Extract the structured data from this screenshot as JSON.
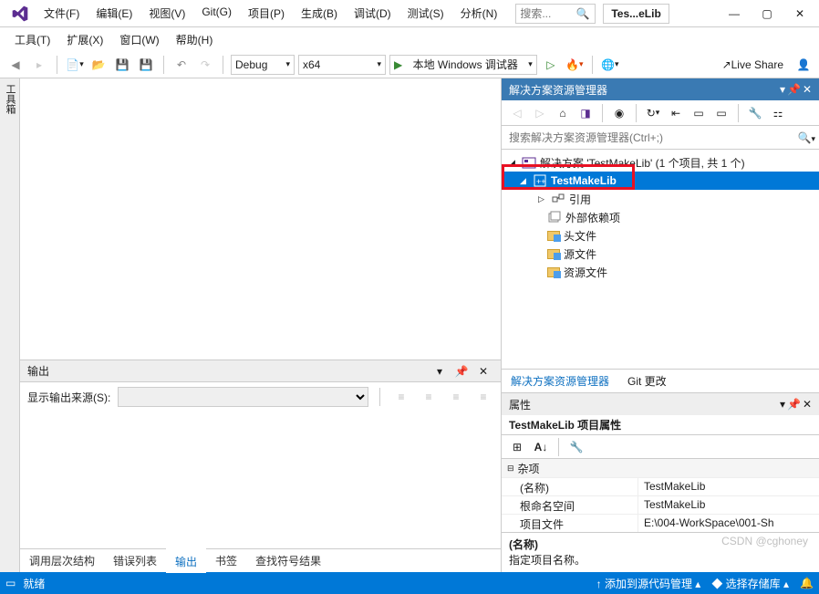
{
  "menu": {
    "file": "文件(F)",
    "edit": "编辑(E)",
    "view": "视图(V)",
    "git": "Git(G)",
    "project": "项目(P)",
    "build": "生成(B)",
    "debug": "调试(D)",
    "test": "测试(S)",
    "analyze": "分析(N)",
    "tools": "工具(T)",
    "extensions": "扩展(X)",
    "window": "窗口(W)",
    "help": "帮助(H)"
  },
  "title_search_placeholder": "搜索...",
  "title_tab": "Tes...eLib",
  "toolbar": {
    "config": "Debug",
    "platform": "x64",
    "debugger": "本地 Windows 调试器",
    "live_share": "Live Share"
  },
  "left_tool": "工具箱",
  "solution_explorer": {
    "title": "解决方案资源管理器",
    "search_placeholder": "搜索解决方案资源管理器(Ctrl+;)",
    "solution": "解决方案 'TestMakeLib' (1 个项目, 共 1 个)",
    "project": "TestMakeLib",
    "items": {
      "references": "引用",
      "ext_deps": "外部依赖项",
      "headers": "头文件",
      "sources": "源文件",
      "resources": "资源文件"
    },
    "tab1": "解决方案资源管理器",
    "tab2": "Git 更改"
  },
  "output": {
    "title": "输出",
    "source_label": "显示输出来源(S):",
    "tabs": {
      "call": "调用层次结构",
      "errors": "错误列表",
      "output": "输出",
      "bookmarks": "书签",
      "symbols": "查找符号结果"
    }
  },
  "properties": {
    "title": "属性",
    "subtitle": "TestMakeLib 项目属性",
    "category": "杂项",
    "rows": {
      "name_k": "(名称)",
      "name_v": "TestMakeLib",
      "rootns_k": "根命名空间",
      "rootns_v": "TestMakeLib",
      "file_k": "项目文件",
      "file_v": "E:\\004-WorkSpace\\001-Sh"
    },
    "desc_title": "(名称)",
    "desc_body": "指定项目名称。"
  },
  "status": {
    "ready": "就绪",
    "add_source": "添加到源代码管理",
    "select_repo": "选择存储库"
  },
  "watermark": "CSDN @cghoney"
}
